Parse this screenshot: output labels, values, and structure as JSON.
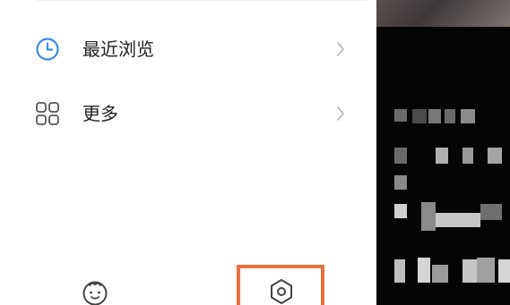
{
  "menu": {
    "items": [
      {
        "label": "最近浏览",
        "icon": "clock-icon"
      },
      {
        "label": "更多",
        "icon": "grid-icon"
      }
    ]
  },
  "bottom_bar": {
    "left_icon": "face-icon",
    "right_icon": "settings-hexagon-icon",
    "highlight_color": "#e8713d"
  },
  "colors": {
    "accent_blue": "#3d8be8",
    "text": "#222222",
    "chevron": "#b5b5b5",
    "icon_gray": "#555555",
    "background_right": "#050505"
  }
}
